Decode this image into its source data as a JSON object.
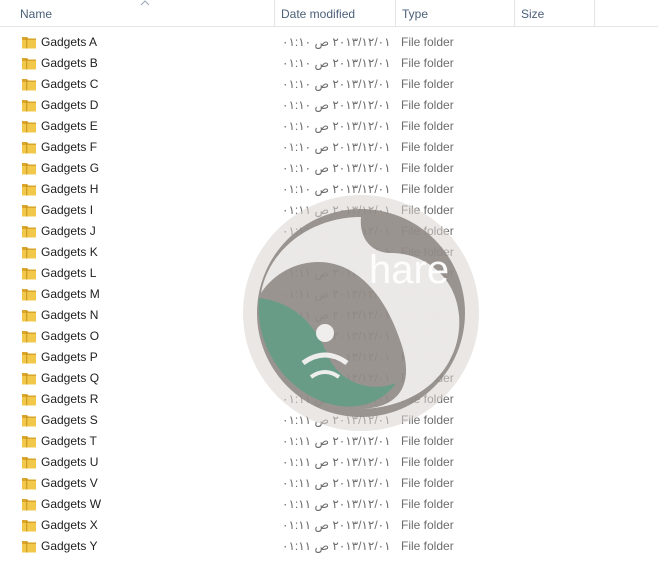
{
  "columns": {
    "name": "Name",
    "date_modified": "Date modified",
    "type": "Type",
    "size": "Size"
  },
  "sort": {
    "column": "name",
    "direction": "ascending"
  },
  "files": [
    {
      "name": "Gadgets A",
      "date": "۲۰۱۳/۱۲/۰۱ ص ۰۱:۱۰",
      "type": "File folder",
      "size": ""
    },
    {
      "name": "Gadgets B",
      "date": "۲۰۱۳/۱۲/۰۱ ص ۰۱:۱۰",
      "type": "File folder",
      "size": ""
    },
    {
      "name": "Gadgets C",
      "date": "۲۰۱۳/۱۲/۰۱ ص ۰۱:۱۰",
      "type": "File folder",
      "size": ""
    },
    {
      "name": "Gadgets D",
      "date": "۲۰۱۳/۱۲/۰۱ ص ۰۱:۱۰",
      "type": "File folder",
      "size": ""
    },
    {
      "name": "Gadgets E",
      "date": "۲۰۱۳/۱۲/۰۱ ص ۰۱:۱۰",
      "type": "File folder",
      "size": ""
    },
    {
      "name": "Gadgets F",
      "date": "۲۰۱۳/۱۲/۰۱ ص ۰۱:۱۰",
      "type": "File folder",
      "size": ""
    },
    {
      "name": "Gadgets G",
      "date": "۲۰۱۳/۱۲/۰۱ ص ۰۱:۱۰",
      "type": "File folder",
      "size": ""
    },
    {
      "name": "Gadgets H",
      "date": "۲۰۱۳/۱۲/۰۱ ص ۰۱:۱۰",
      "type": "File folder",
      "size": ""
    },
    {
      "name": "Gadgets I",
      "date": "۲۰۱۳/۱۲/۰۱ ص ۰۱:۱۱",
      "type": "File folder",
      "size": ""
    },
    {
      "name": "Gadgets J",
      "date": "۲۰۱۳/۱۲/۰۱ ص ۰۱:۱۱",
      "type": "File folder",
      "size": ""
    },
    {
      "name": "Gadgets K",
      "date": "۲۰۱۳/۱۲/۰۱ ص ۰۱:۱۱",
      "type": "File folder",
      "size": ""
    },
    {
      "name": "Gadgets L",
      "date": "۲۰۱۳/۱۲/۰۱ ص ۰۱:۱۱",
      "type": "File folder",
      "size": ""
    },
    {
      "name": "Gadgets M",
      "date": "۲۰۱۳/۱۲/۰۱ ص ۰۱:۱۱",
      "type": "File folder",
      "size": ""
    },
    {
      "name": "Gadgets N",
      "date": "۲۰۱۳/۱۲/۰۱ ص ۰۱:۱۱",
      "type": "File folder",
      "size": ""
    },
    {
      "name": "Gadgets O",
      "date": "۲۰۱۳/۱۲/۰۱ ص ۰۱:۱۱",
      "type": "File folder",
      "size": ""
    },
    {
      "name": "Gadgets P",
      "date": "۲۰۱۳/۱۲/۰۱ ص ۰۱:۱۱",
      "type": "File folder",
      "size": ""
    },
    {
      "name": "Gadgets Q",
      "date": "۲۰۱۳/۱۲/۰۱ ص ۰۱:۱۱",
      "type": "File folder",
      "size": ""
    },
    {
      "name": "Gadgets R",
      "date": "۲۰۱۳/۱۲/۰۱ ص ۰۱:۱۱",
      "type": "File folder",
      "size": ""
    },
    {
      "name": "Gadgets S",
      "date": "۲۰۱۳/۱۲/۰۱ ص ۰۱:۱۱",
      "type": "File folder",
      "size": ""
    },
    {
      "name": "Gadgets T",
      "date": "۲۰۱۳/۱۲/۰۱ ص ۰۱:۱۱",
      "type": "File folder",
      "size": ""
    },
    {
      "name": "Gadgets U",
      "date": "۲۰۱۳/۱۲/۰۱ ص ۰۱:۱۱",
      "type": "File folder",
      "size": ""
    },
    {
      "name": "Gadgets V",
      "date": "۲۰۱۳/۱۲/۰۱ ص ۰۱:۱۱",
      "type": "File folder",
      "size": ""
    },
    {
      "name": "Gadgets W",
      "date": "۲۰۱۳/۱۲/۰۱ ص ۰۱:۱۱",
      "type": "File folder",
      "size": ""
    },
    {
      "name": "Gadgets X",
      "date": "۲۰۱۳/۱۲/۰۱ ص ۰۱:۱۱",
      "type": "File folder",
      "size": ""
    },
    {
      "name": "Gadgets Y",
      "date": "۲۰۱۳/۱۲/۰۱ ص ۰۱:۱۱",
      "type": "File folder",
      "size": ""
    }
  ],
  "watermark": {
    "text": "hare",
    "icon": "share-s-logo"
  },
  "colors": {
    "header_text": "#4c607a",
    "folder_yellow": "#e8b93b",
    "watermark_gray": "#8c8581",
    "watermark_green": "#5f9e86"
  }
}
